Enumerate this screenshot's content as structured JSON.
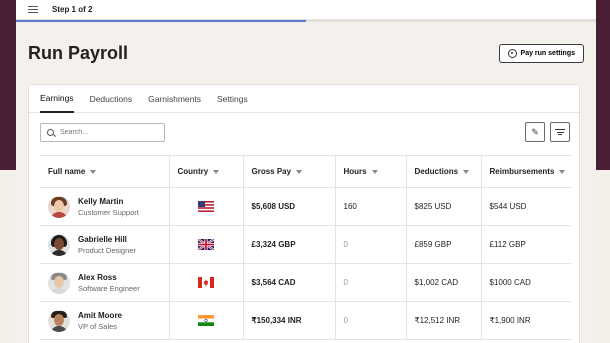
{
  "topbar": {
    "step": "Step 1 of 2",
    "progress": 0.5
  },
  "page": {
    "title": "Run Payroll",
    "settings_label": "Pay run settings"
  },
  "tabs": [
    {
      "label": "Earnings",
      "active": true
    },
    {
      "label": "Deductions",
      "active": false
    },
    {
      "label": "Garnishments",
      "active": false
    },
    {
      "label": "Settings",
      "active": false
    }
  ],
  "search": {
    "placeholder": "Search..."
  },
  "table": {
    "headers": [
      "Full name",
      "Country",
      "Gross Pay",
      "Hours",
      "Deductions",
      "Reimbursements"
    ],
    "rows": [
      {
        "name": "Kelly Martin",
        "role": "Customer Support",
        "country": "us-flag-icon",
        "gross": "$5,608 USD",
        "hours": "160",
        "deductions": "$825 USD",
        "reimb": "$544 USD"
      },
      {
        "name": "Gabrielle Hill",
        "role": "Product Designer",
        "country": "uk-flag-icon",
        "gross": "£3,324 GBP",
        "hours": "0",
        "deductions": "£859 GBP",
        "reimb": "£112 GBP"
      },
      {
        "name": "Alex Ross",
        "role": "Software Engineer",
        "country": "canada-flag-icon",
        "gross": "$3,564 CAD",
        "hours": "0",
        "deductions": "$1,002 CAD",
        "reimb": "$1000 CAD"
      },
      {
        "name": "Amit Moore",
        "role": "VP of Sales",
        "country": "india-flag-icon",
        "gross": "₹150,334 INR",
        "hours": "0",
        "deductions": "₹12,512 INR",
        "reimb": "₹1,900 INR"
      }
    ]
  },
  "colors": {
    "brand_bg": "#4a1f36",
    "accent": "#5a7bd1",
    "page_bg": "#f4f1ec"
  }
}
